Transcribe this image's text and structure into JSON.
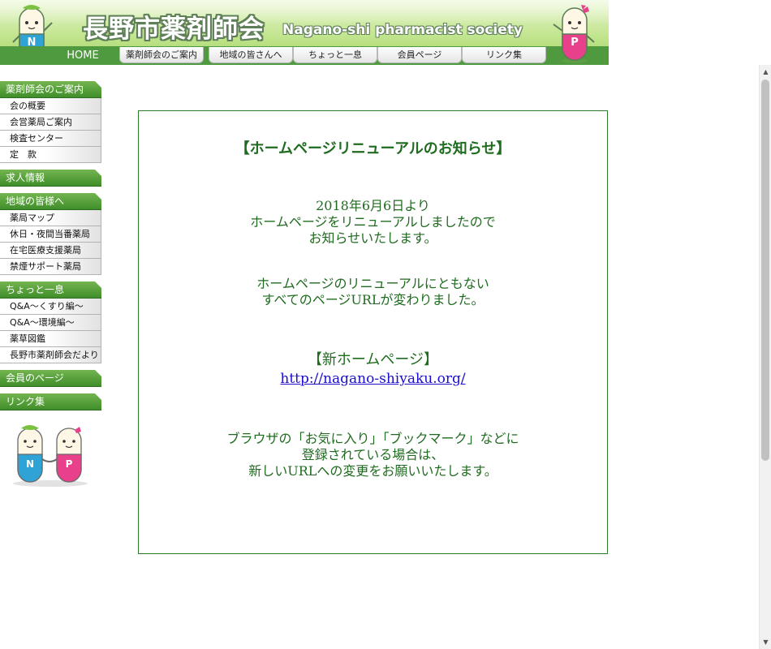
{
  "header": {
    "title": "長野市薬剤師会",
    "subtitle": "Nagano-shi pharmacist society",
    "nav": {
      "home": "HOME",
      "tabs": [
        {
          "label": "薬剤師会のご案内"
        },
        {
          "label": "地域の皆さんへ"
        },
        {
          "label": "ちょっと一息"
        },
        {
          "label": "会員ページ"
        },
        {
          "label": "リンク集"
        }
      ]
    },
    "mascot_n_letter": "N",
    "mascot_p_letter": "P"
  },
  "sidebar": {
    "sections": [
      {
        "heading": "薬剤師会のご案内",
        "items": [
          "会の概要",
          "会営薬局ご案内",
          "検査センター",
          "定　款"
        ]
      },
      {
        "heading": "求人情報",
        "items": []
      },
      {
        "heading": "地域の皆様へ",
        "items": [
          "薬局マップ",
          "休日・夜間当番薬局",
          "在宅医療支援薬局",
          "禁煙サポート薬局"
        ]
      },
      {
        "heading": "ちょっと一息",
        "items": [
          "Q&A〜くすり編〜",
          "Q&A〜環境編〜",
          "薬草図鑑",
          "長野市薬剤師会だより"
        ]
      },
      {
        "heading": "会員のページ",
        "items": []
      },
      {
        "heading": "リンク集",
        "items": []
      }
    ]
  },
  "notice": {
    "title": "【ホームページリニューアルのお知らせ】",
    "p1": [
      "2018年6月6日より",
      "ホームページをリニューアルしましたので",
      "お知らせいたします。"
    ],
    "p2": [
      "ホームページのリニューアルにともない",
      "すべてのページURLが変わりました。"
    ],
    "new_heading": "【新ホームページ】",
    "new_url": "http://nagano-shiyaku.org/",
    "p3": [
      "ブラウザの「お気に入り」「ブックマーク」などに",
      "登録されている場合は、",
      "新しいURLへの変更をお願いいたします。"
    ]
  },
  "colors": {
    "accent_green": "#3f8e2a",
    "text_green": "#1f6b1f",
    "link_blue": "#1a0dcc"
  }
}
